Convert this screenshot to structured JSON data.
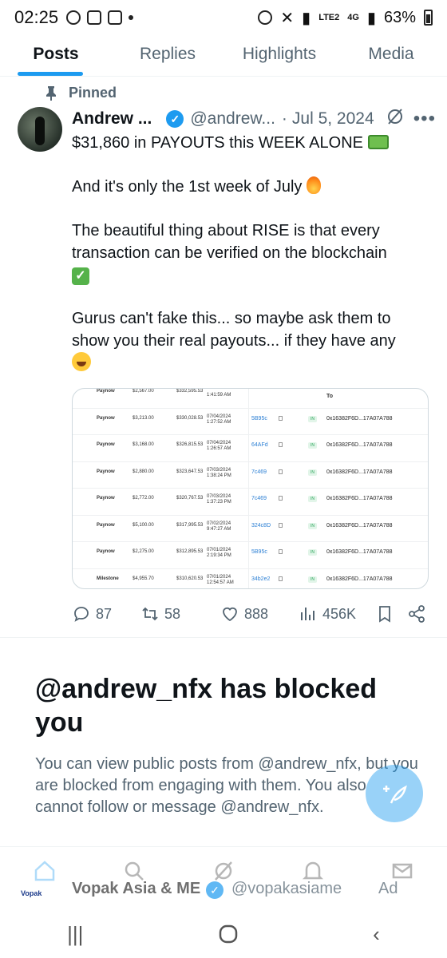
{
  "status_bar": {
    "time": "02:25",
    "network": "4G",
    "lte": "LTE2",
    "battery": "63%"
  },
  "tabs": [
    {
      "label": "Posts",
      "active": true
    },
    {
      "label": "Replies",
      "active": false
    },
    {
      "label": "Highlights",
      "active": false
    },
    {
      "label": "Media",
      "active": false
    }
  ],
  "post": {
    "pinned_label": "Pinned",
    "author_name": "Andrew ...",
    "handle": "@andrew...",
    "separator": "·",
    "date": "Jul 5, 2024",
    "more": "•••",
    "line1": "$31,860 in PAYOUTS this WEEK ALONE",
    "line2": "And it's only the 1st week of July",
    "line3": "The beautiful thing about RISE is that every transaction can be verified on the blockchain",
    "line4": "Gurus can't fake this... so maybe ask them to show you their real payouts... if they have any",
    "image_table": {
      "to_header": "To",
      "rows": [
        {
          "type": "Paynow",
          "amount": "$2,567.00",
          "balance": "$332,595.53",
          "date": "",
          "time": "1:41:59 AM",
          "hash": "",
          "to": ""
        },
        {
          "type": "Paynow",
          "amount": "$3,213.00",
          "balance": "$330,028.53",
          "date": "07/04/2024",
          "time": "1:27:52 AM",
          "hash": "5B95c",
          "to": "0x16382F6D...17A07A788"
        },
        {
          "type": "Paynow",
          "amount": "$3,168.00",
          "balance": "$326,815.53",
          "date": "07/04/2024",
          "time": "1:26:57 AM",
          "hash": "64AFd",
          "to": "0x16382F6D...17A07A788"
        },
        {
          "type": "Paynow",
          "amount": "$2,880.00",
          "balance": "$323,647.53",
          "date": "07/03/2024",
          "time": "1:38:24 PM",
          "hash": "7c469",
          "to": "0x16382F6D...17A07A788"
        },
        {
          "type": "Paynow",
          "amount": "$2,772.00",
          "balance": "$320,767.53",
          "date": "07/03/2024",
          "time": "1:37:23 PM",
          "hash": "7c469",
          "to": "0x16382F6D...17A07A788"
        },
        {
          "type": "Paynow",
          "amount": "$5,100.00",
          "balance": "$317,995.53",
          "date": "07/02/2024",
          "time": "9:47:27 AM",
          "hash": "324c8D",
          "to": "0x16382F6D...17A07A788"
        },
        {
          "type": "Paynow",
          "amount": "$2,275.00",
          "balance": "$312,895.53",
          "date": "07/01/2024",
          "time": "2:19:34 PM",
          "hash": "5B95c",
          "to": "0x16382F6D...17A07A788"
        },
        {
          "type": "Milestone",
          "amount": "$4,955.70",
          "balance": "$310,620.53",
          "date": "07/01/2024",
          "time": "12:54:57 AM",
          "hash": "34b2e2",
          "to": "0x16382F6D...17A07A788"
        }
      ],
      "extra_to_rows": [
        "0x16382F6D...17A07A788"
      ],
      "extra_hashes": [
        "34b2e2"
      ],
      "in_label": "IN"
    },
    "actions": {
      "replies": "87",
      "reposts": "58",
      "likes": "888",
      "views": "456K"
    }
  },
  "blocked": {
    "title": "@andrew_nfx has blocked you",
    "description": "You can view public posts from @andrew_nfx, but you are blocked from engaging with them. You also cannot follow or message @andrew_nfx."
  },
  "ad": {
    "logo_text": "Vopak",
    "name": "Vopak Asia & ME",
    "handle": "@vopakasiame",
    "tag": "Ad"
  }
}
